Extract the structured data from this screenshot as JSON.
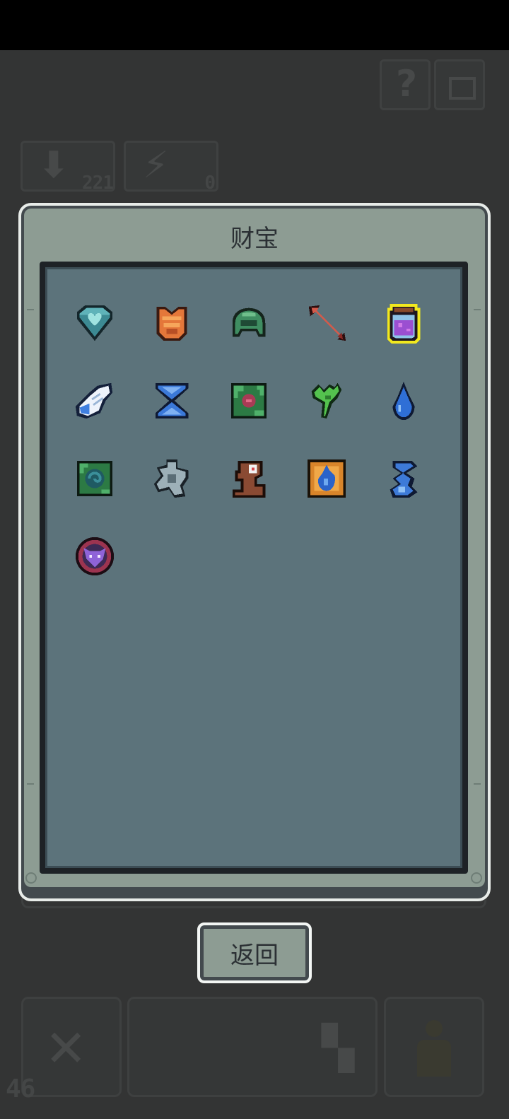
{
  "modal": {
    "title": "财宝"
  },
  "back_button": {
    "label": "返回"
  },
  "hud": {
    "stat_left_value": "221",
    "stat_right_value": "0",
    "bottom_left_number": "46"
  },
  "treasures": [
    {
      "icon": "heart-shield-icon"
    },
    {
      "icon": "orange-armor-icon"
    },
    {
      "icon": "green-helmet-icon"
    },
    {
      "icon": "red-arrow-icon"
    },
    {
      "icon": "purple-potion-jar-icon",
      "selected": true
    },
    {
      "icon": "white-wing-icon"
    },
    {
      "icon": "hourglass-icon"
    },
    {
      "icon": "green-rose-tile-icon"
    },
    {
      "icon": "green-sprout-icon"
    },
    {
      "icon": "blue-drop-icon"
    },
    {
      "icon": "green-vortex-tile-icon"
    },
    {
      "icon": "gray-shuriken-icon"
    },
    {
      "icon": "brown-totem-icon"
    },
    {
      "icon": "blue-flame-tile-icon"
    },
    {
      "icon": "blue-wind-icon"
    },
    {
      "icon": "purple-fox-medallion-icon"
    }
  ],
  "colors": {
    "selection": "#f2e81e",
    "panel": "#8d9c93",
    "inner_panel": "#5c737b"
  }
}
